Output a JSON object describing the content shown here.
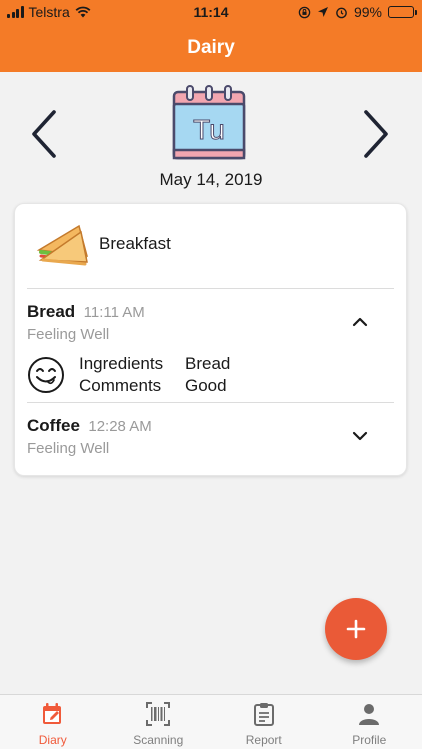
{
  "status_bar": {
    "carrier": "Telstra",
    "time": "11:14",
    "battery": "99%",
    "battery_level": 0.99,
    "battery_color": "#2db84d",
    "icons": [
      "signal-icon",
      "wifi-icon",
      "orientation-lock-icon",
      "location-icon",
      "alarm-icon",
      "battery-icon"
    ]
  },
  "nav": {
    "title": "Dairy"
  },
  "day_selector": {
    "prev_icon": "chevron-left-icon",
    "next_icon": "chevron-right-icon",
    "calendar_text": "Tu",
    "date": "May 14, 2019"
  },
  "meal_card": {
    "meal_title": "Breakfast",
    "meal_icon": "sandwich-icon",
    "entries": [
      {
        "name": "Bread",
        "time": "11:11 AM",
        "status": "Feeling Well",
        "expanded": true,
        "details": {
          "ingredients_label": "Ingredients",
          "ingredients_value": "Bread",
          "comments_label": "Comments",
          "comments_value": "Good"
        }
      },
      {
        "name": "Coffee",
        "time": "12:28 AM",
        "status": "Feeling Well",
        "expanded": false
      }
    ]
  },
  "fab": {
    "label": "+",
    "color": "#ea5a37"
  },
  "tabs": [
    {
      "label": "Diary",
      "icon": "calendar-edit-icon",
      "active": true
    },
    {
      "label": "Scanning",
      "icon": "barcode-icon",
      "active": false
    },
    {
      "label": "Report",
      "icon": "clipboard-icon",
      "active": false
    },
    {
      "label": "Profile",
      "icon": "person-icon",
      "active": false
    }
  ],
  "colors": {
    "accent": "#f47b27",
    "tab_active": "#f05a3a",
    "muted_text": "#9a9a9a"
  }
}
